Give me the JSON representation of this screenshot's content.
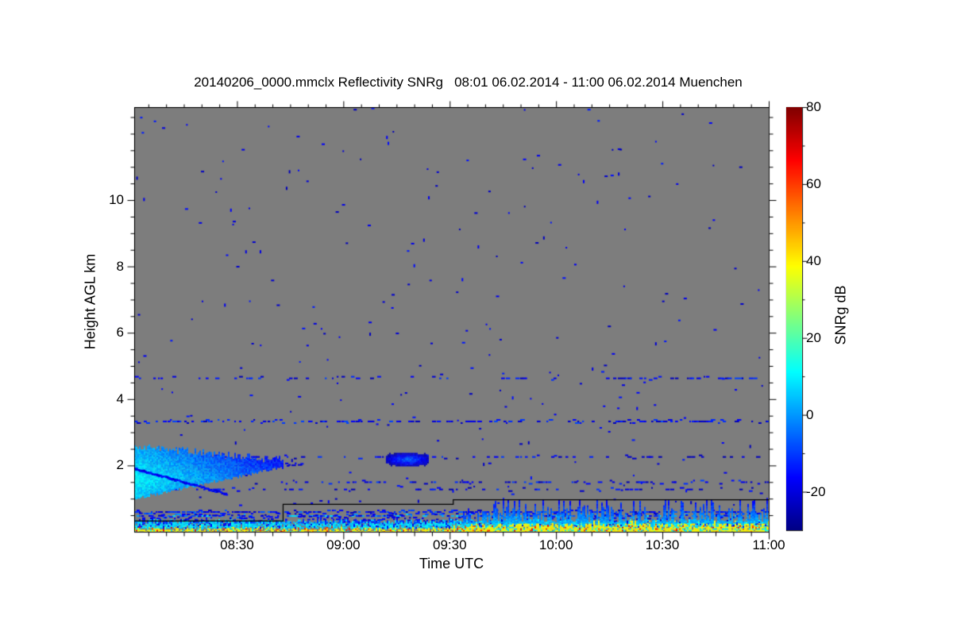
{
  "chart_data": {
    "type": "heatmap",
    "title": "20140206_0000.mmclx Reflectivity SNRg   08:01 06.02.2014 - 11:00 06.02.2014 Muenchen",
    "xlabel": "Time UTC",
    "ylabel": "Height AGL km",
    "x_range": [
      "08:01",
      "11:00"
    ],
    "y_range_km": [
      0,
      12.8
    ],
    "x_major_ticks": [
      "08:30",
      "09:00",
      "09:30",
      "10:00",
      "10:30",
      "11:00"
    ],
    "x_minor_step_min": 5,
    "y_major_ticks": [
      2,
      4,
      6,
      8,
      10
    ],
    "y_minor_step_km": 0.5,
    "grid": "off",
    "background_no_signal_color": "#7d7d7d",
    "axis_color": "#000000",
    "colorbar": {
      "label": "SNRg dB",
      "range_db": [
        -30,
        80
      ],
      "major_ticks": [
        -20,
        0,
        20,
        40,
        60,
        80
      ],
      "minor_ticks": [
        -10,
        10,
        30,
        50,
        70
      ],
      "position": "right",
      "jet_stops": [
        [
          0,
          "#000083"
        ],
        [
          0.125,
          "#0000ff"
        ],
        [
          0.375,
          "#00ffff"
        ],
        [
          0.625,
          "#ffff00"
        ],
        [
          0.875,
          "#ff0000"
        ],
        [
          1,
          "#800000"
        ]
      ]
    },
    "features": {
      "noise_dots": {
        "count": 250,
        "db_min": -24,
        "db_max": -13
      },
      "speckle_lines": [
        {
          "height_km": 4.65,
          "density": 0.22,
          "db_mean": -17,
          "db_spread": 8
        },
        {
          "height_km": 3.35,
          "density": 0.5,
          "db_mean": -16,
          "db_spread": 8
        },
        {
          "height_km": 2.28,
          "density": 0.26,
          "db_mean": -17,
          "db_spread": 8
        },
        {
          "height_km": 1.52,
          "density": 0.3,
          "db_mean": -17,
          "db_spread": 8,
          "from": "08:35"
        },
        {
          "height_km": 1.3,
          "density": 0.2,
          "db_mean": -18,
          "db_spread": 8
        },
        {
          "height_km": 0.62,
          "density": 0.78,
          "db_mean": -14,
          "db_spread": 10
        },
        {
          "height_km": 0.5,
          "density": 0.6,
          "db_mean": -6,
          "db_spread": 14
        }
      ],
      "surface_clutter": {
        "yellow_band_h1_left_km": 0.15,
        "yellow_band_h1_right_km": 0.28,
        "yellow_db": 37,
        "hot_speck_db": 56,
        "cyan_band_top_km": 0.32,
        "cyan_db": 7,
        "transition_time": "09:35"
      },
      "boundary_layer_plumes": {
        "hmax_km_before": 0.45,
        "hmax_km_after": 1.05,
        "db_low": 12,
        "db_top": -18,
        "growth_time": "09:35"
      },
      "cloud_layer": {
        "t0": "08:01",
        "t1": "08:48",
        "base_km": 1.05,
        "top_km": 2.6,
        "core_db": 11,
        "edge_db": -24,
        "core_height_km": 1.62,
        "fall_streak": {
          "t0": "08:01",
          "h0_km": 1.92,
          "t1": "08:27",
          "h1_km": 1.15
        }
      },
      "mid_blob": {
        "t0": "09:12",
        "t1": "09:24",
        "h0_km": 2.02,
        "h1_km": 2.38,
        "peak_db": -4
      },
      "bl_height_line": {
        "color": "#000000",
        "points": [
          [
            "08:01",
            0.34
          ],
          [
            "08:43",
            0.34
          ],
          [
            "08:43",
            0.84
          ],
          [
            "09:31",
            0.84
          ],
          [
            "09:31",
            0.98
          ],
          [
            "11:00",
            0.98
          ]
        ]
      }
    }
  }
}
